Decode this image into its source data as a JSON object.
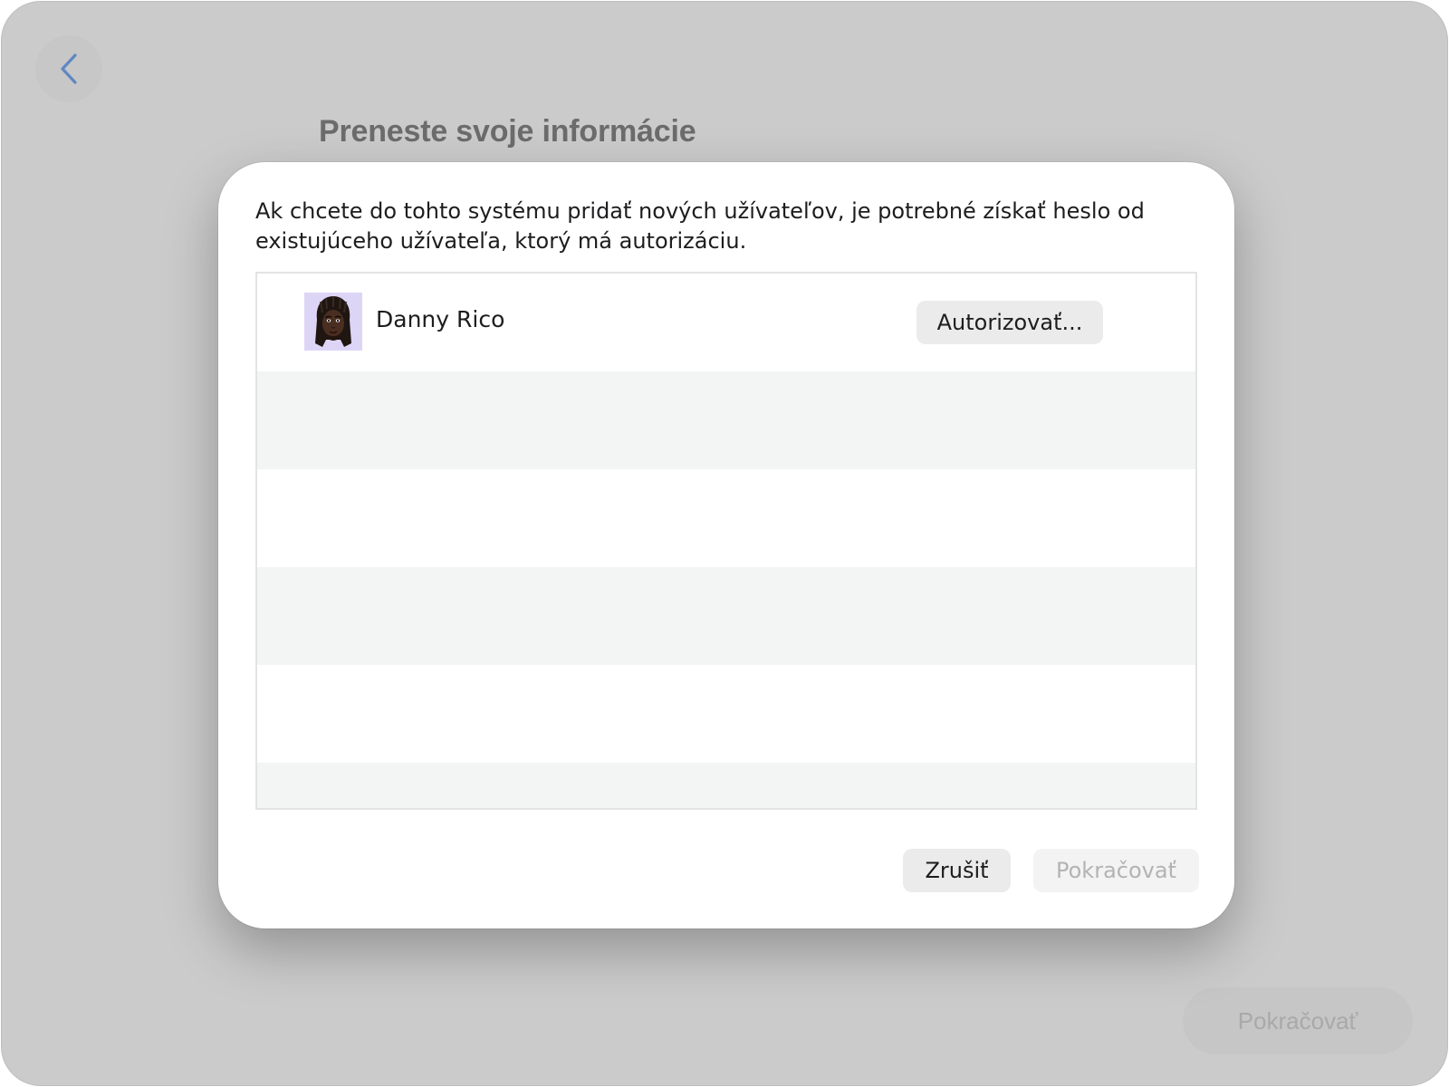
{
  "window": {
    "title": "Preneste svoje informácie",
    "back_icon": "chevron-left-icon",
    "continue_label": "Pokračovať"
  },
  "dialog": {
    "message": "Ak chcete do tohto systému pridať nových užívateľov, je potrebné získať heslo od existujúceho užívateľa, ktorý má autorizáciu.",
    "users": [
      {
        "name": "Danny Rico",
        "avatar": "memoji-avatar",
        "authorize_label": "Autorizovať..."
      }
    ],
    "cancel_label": "Zrušiť",
    "continue_label": "Pokračovať",
    "continue_enabled": false
  },
  "colors": {
    "background": "#cbcbcb",
    "dialog": "#ffffff",
    "accent_back": "#5f87c2",
    "row_stripe": "#f3f4f4",
    "button": "#ebebeb",
    "disabled_text": "#b3b3b3"
  }
}
